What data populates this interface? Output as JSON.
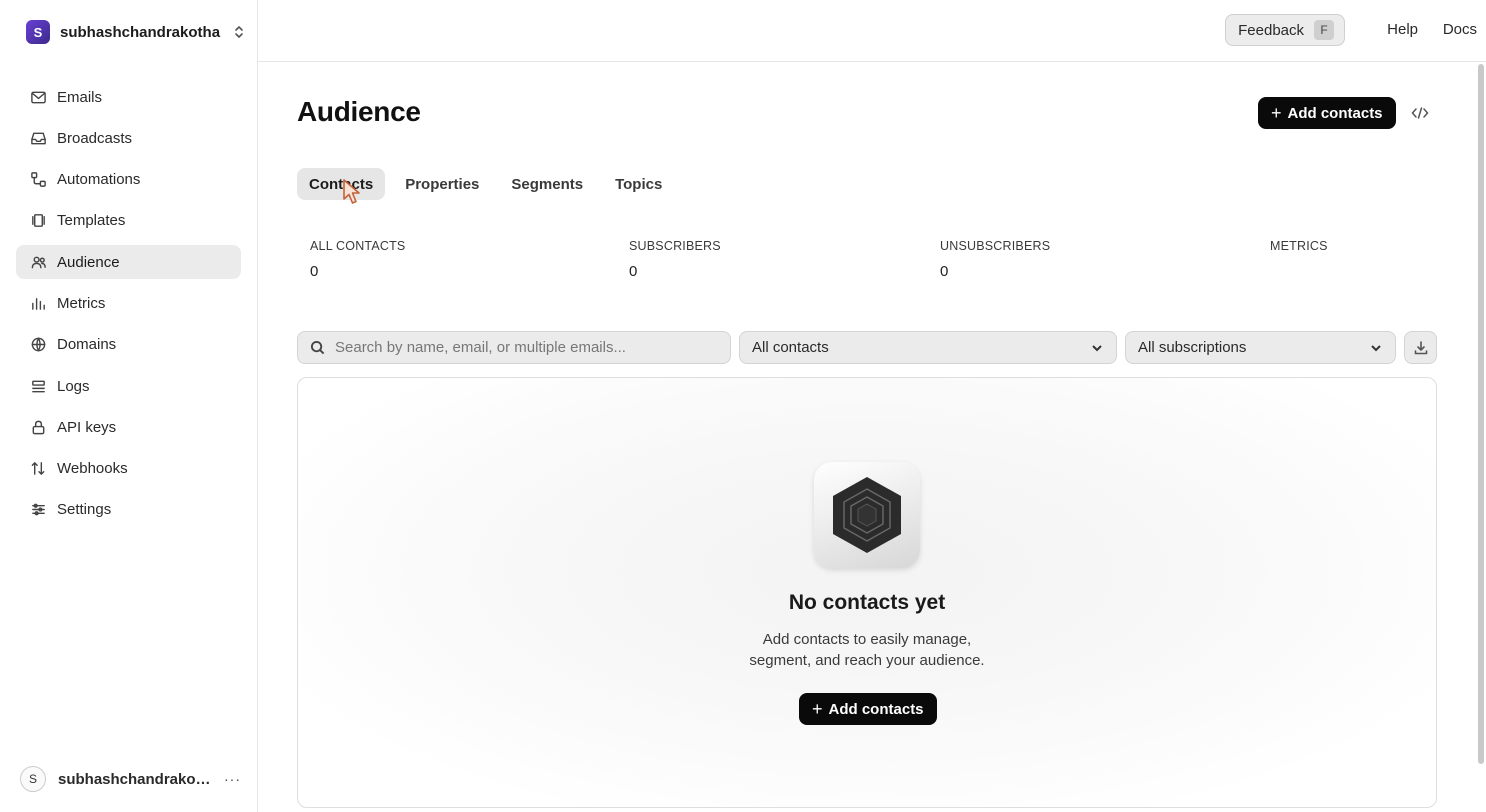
{
  "workspace": {
    "initial": "S",
    "name": "subhashchandrakotha"
  },
  "nav": [
    {
      "label": "Emails",
      "icon": "mail-icon"
    },
    {
      "label": "Broadcasts",
      "icon": "inbox-icon"
    },
    {
      "label": "Automations",
      "icon": "workflow-icon"
    },
    {
      "label": "Templates",
      "icon": "templates-icon"
    },
    {
      "label": "Audience",
      "icon": "users-icon",
      "active": true
    },
    {
      "label": "Metrics",
      "icon": "bar-chart-icon"
    },
    {
      "label": "Domains",
      "icon": "globe-icon"
    },
    {
      "label": "Logs",
      "icon": "logs-icon"
    },
    {
      "label": "API keys",
      "icon": "lock-icon"
    },
    {
      "label": "Webhooks",
      "icon": "webhook-icon"
    },
    {
      "label": "Settings",
      "icon": "sliders-icon"
    }
  ],
  "user": {
    "initial": "S",
    "name": "subhashchandrakotha",
    "more": "···"
  },
  "topbar": {
    "feedback_label": "Feedback",
    "feedback_key": "F",
    "help_label": "Help",
    "docs_label": "Docs"
  },
  "page": {
    "title": "Audience",
    "add_contacts_label": "Add contacts",
    "plus": "+"
  },
  "tabs": [
    {
      "label": "Contacts",
      "active": true
    },
    {
      "label": "Properties"
    },
    {
      "label": "Segments"
    },
    {
      "label": "Topics"
    }
  ],
  "stats": [
    {
      "label": "ALL CONTACTS",
      "value": "0"
    },
    {
      "label": "SUBSCRIBERS",
      "value": "0"
    },
    {
      "label": "UNSUBSCRIBERS",
      "value": "0"
    },
    {
      "label": "METRICS",
      "value": ""
    }
  ],
  "filters": {
    "search_placeholder": "Search by name, email, or multiple emails...",
    "contacts_filter": "All contacts",
    "subscriptions_filter": "All subscriptions"
  },
  "empty_state": {
    "title": "No contacts yet",
    "description_line1": "Add contacts to easily manage,",
    "description_line2": "segment, and reach your audience.",
    "button_label": "Add contacts"
  }
}
